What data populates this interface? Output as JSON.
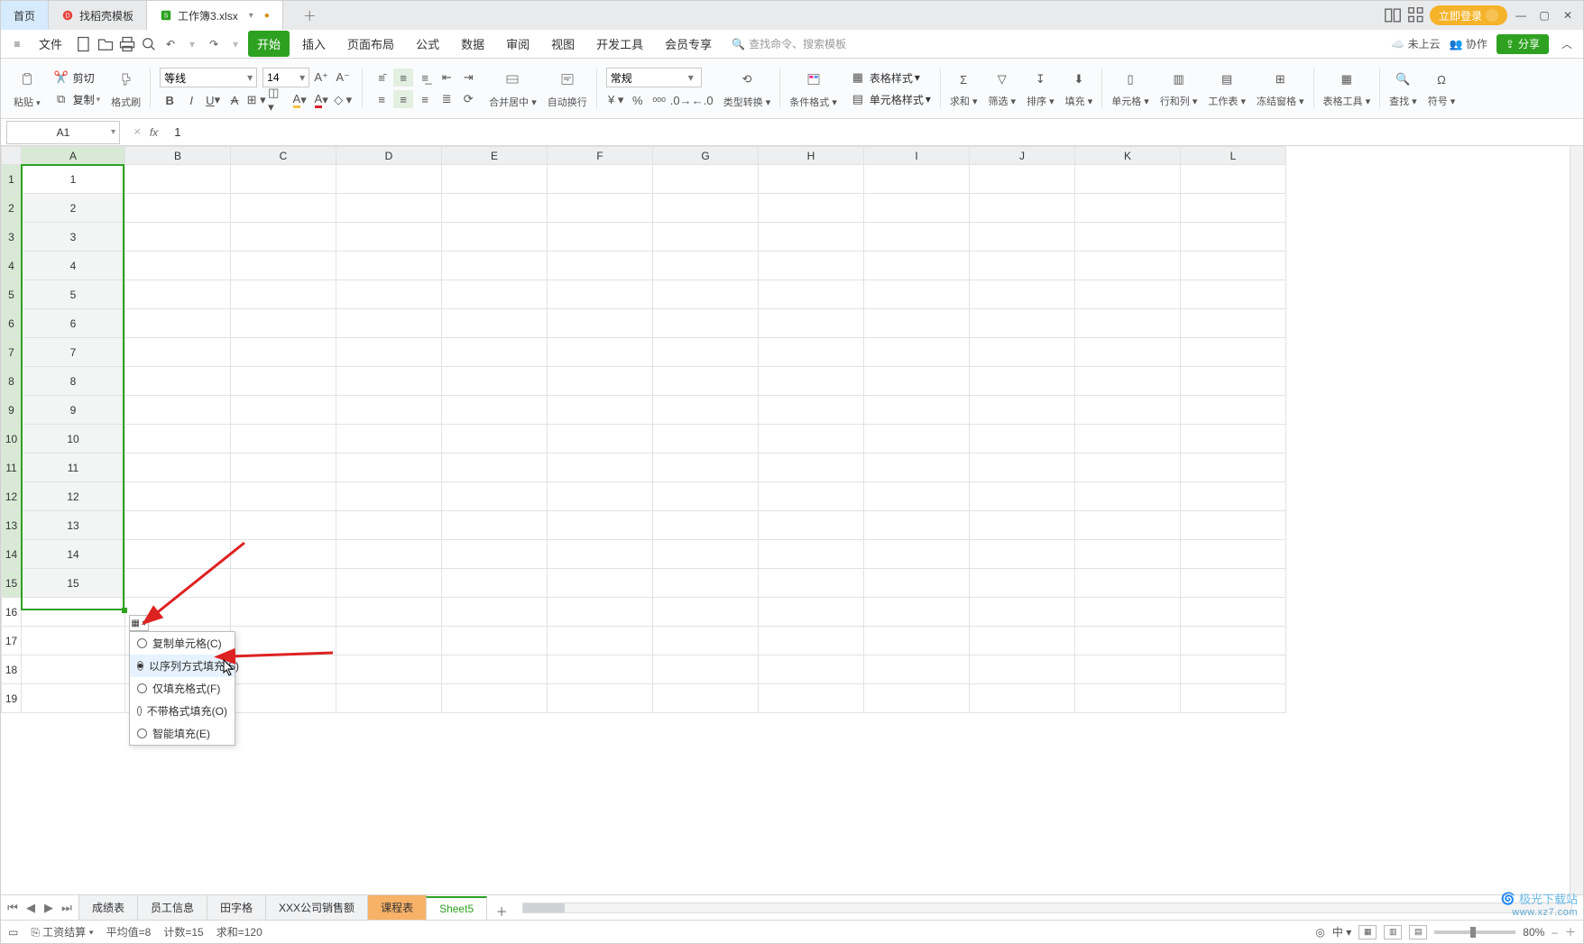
{
  "titlebar": {
    "tabs": [
      {
        "label": "首页",
        "icon": "home",
        "active": false,
        "kind": "home"
      },
      {
        "label": "找稻壳模板",
        "icon": "docer-red",
        "active": false,
        "kind": "doc"
      },
      {
        "label": "工作簿3.xlsx",
        "icon": "sheet-green",
        "active": true,
        "kind": "doc"
      }
    ],
    "login_label": "立即登录",
    "icons": [
      "layout-1",
      "layout-2"
    ]
  },
  "menubar": {
    "file_label": "文件",
    "quick_icons": [
      "new",
      "open",
      "print",
      "print-preview",
      "undo",
      "redo"
    ],
    "tabs": [
      "开始",
      "插入",
      "页面布局",
      "公式",
      "数据",
      "审阅",
      "视图",
      "开发工具",
      "会员专享"
    ],
    "active_tab": "开始",
    "search_placeholder": "查找命令、搜索模板",
    "cloud_label": "未上云",
    "collab_label": "协作",
    "share_label": "分享"
  },
  "ribbon": {
    "paste_label": "粘贴",
    "cut_label": "剪切",
    "copy_label": "复制",
    "fmtpaint_label": "格式刷",
    "font_name": "等线",
    "font_size": "14",
    "merge_label": "合并居中",
    "wrap_label": "自动换行",
    "numfmt_value": "常规",
    "typeconv_label": "类型转换",
    "condfmt_label": "条件格式",
    "tablestyle_label": "表格样式",
    "cellstyle_label": "单元格样式",
    "sum_label": "求和",
    "filter_label": "筛选",
    "sort_label": "排序",
    "fill_label": "填充",
    "cell_label": "单元格",
    "rowcol_label": "行和列",
    "sheet_label": "工作表",
    "freeze_label": "冻结窗格",
    "tabletool_label": "表格工具",
    "find_label": "查找",
    "symbol_label": "符号"
  },
  "formula": {
    "name_cell": "A1",
    "fx_value": "1"
  },
  "grid": {
    "columns": [
      "A",
      "B",
      "C",
      "D",
      "E",
      "F",
      "G",
      "H",
      "I",
      "J",
      "K",
      "L"
    ],
    "rows": 19,
    "selected_range_rows": 15,
    "col_a_values": [
      "1",
      "2",
      "3",
      "4",
      "5",
      "6",
      "7",
      "8",
      "9",
      "10",
      "11",
      "12",
      "13",
      "14",
      "15"
    ]
  },
  "fill_popup": {
    "trigger_icon": "fill-options",
    "options": [
      {
        "label": "复制单元格(C)",
        "checked": false
      },
      {
        "label": "以序列方式填充(S)",
        "checked": true
      },
      {
        "label": "仅填充格式(F)",
        "checked": false
      },
      {
        "label": "不带格式填充(O)",
        "checked": false
      },
      {
        "label": "智能填充(E)",
        "checked": false
      }
    ]
  },
  "sheetbar": {
    "tabs": [
      {
        "label": "成绩表",
        "active": false
      },
      {
        "label": "员工信息",
        "active": false
      },
      {
        "label": "田字格",
        "active": false
      },
      {
        "label": "XXX公司销售额",
        "active": false
      },
      {
        "label": "课程表",
        "active": false,
        "highlight": true
      },
      {
        "label": "Sheet5",
        "active": true
      }
    ]
  },
  "statusbar": {
    "salary_label": "工资结算",
    "avg_label": "平均值=8",
    "count_label": "计数=15",
    "sum_label": "求和=120",
    "zoom_value": "80%"
  },
  "watermark": {
    "name": "极光下载站",
    "url": "www.xz7.com"
  }
}
